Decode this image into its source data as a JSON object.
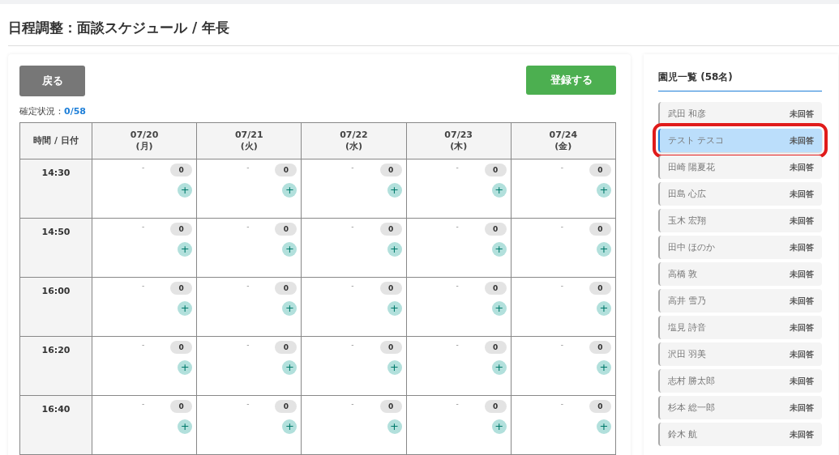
{
  "page_title": "日程調整：面談スケジュール / 年長",
  "back_button": "戻る",
  "register_button": "登録する",
  "status": {
    "label": "確定状況：",
    "value": "0/58"
  },
  "table": {
    "corner": "時間 / 日付",
    "columns": [
      {
        "date": "07/20",
        "weekday": "(月)"
      },
      {
        "date": "07/21",
        "weekday": "(火)"
      },
      {
        "date": "07/22",
        "weekday": "(水)"
      },
      {
        "date": "07/23",
        "weekday": "(木)"
      },
      {
        "date": "07/24",
        "weekday": "(金)"
      }
    ],
    "rows": [
      {
        "time": "14:30",
        "cells": [
          {
            "note": "-",
            "count": "0",
            "add": "+"
          },
          {
            "note": "-",
            "count": "0",
            "add": "+"
          },
          {
            "note": "-",
            "count": "0",
            "add": "+"
          },
          {
            "note": "-",
            "count": "0",
            "add": "+"
          },
          {
            "note": "-",
            "count": "0",
            "add": "+"
          }
        ]
      },
      {
        "time": "14:50",
        "cells": [
          {
            "note": "-",
            "count": "0",
            "add": "+"
          },
          {
            "note": "-",
            "count": "0",
            "add": "+"
          },
          {
            "note": "-",
            "count": "0",
            "add": "+"
          },
          {
            "note": "-",
            "count": "0",
            "add": "+"
          },
          {
            "note": "-",
            "count": "0",
            "add": "+"
          }
        ]
      },
      {
        "time": "16:00",
        "cells": [
          {
            "note": "-",
            "count": "0",
            "add": "+"
          },
          {
            "note": "-",
            "count": "0",
            "add": "+"
          },
          {
            "note": "-",
            "count": "0",
            "add": "+"
          },
          {
            "note": "-",
            "count": "0",
            "add": "+"
          },
          {
            "note": "-",
            "count": "0",
            "add": "+"
          }
        ]
      },
      {
        "time": "16:20",
        "cells": [
          {
            "note": "-",
            "count": "0",
            "add": "+"
          },
          {
            "note": "-",
            "count": "0",
            "add": "+"
          },
          {
            "note": "-",
            "count": "0",
            "add": "+"
          },
          {
            "note": "-",
            "count": "0",
            "add": "+"
          },
          {
            "note": "-",
            "count": "0",
            "add": "+"
          }
        ]
      },
      {
        "time": "16:40",
        "cells": [
          {
            "note": "-",
            "count": "0",
            "add": "+"
          },
          {
            "note": "-",
            "count": "0",
            "add": "+"
          },
          {
            "note": "-",
            "count": "0",
            "add": "+"
          },
          {
            "note": "-",
            "count": "0",
            "add": "+"
          },
          {
            "note": "-",
            "count": "0",
            "add": "+"
          }
        ]
      }
    ]
  },
  "sidebar": {
    "title": "園児一覧 (58名)",
    "items": [
      {
        "name": "武田 和彦",
        "status": "未回答",
        "selected": false,
        "highlighted": false
      },
      {
        "name": "テスト テスコ",
        "status": "未回答",
        "selected": true,
        "highlighted": true
      },
      {
        "name": "田崎 陽夏花",
        "status": "未回答",
        "selected": false,
        "highlighted": false
      },
      {
        "name": "田島 心広",
        "status": "未回答",
        "selected": false,
        "highlighted": false
      },
      {
        "name": "玉木 宏翔",
        "status": "未回答",
        "selected": false,
        "highlighted": false
      },
      {
        "name": "田中 ほのか",
        "status": "未回答",
        "selected": false,
        "highlighted": false
      },
      {
        "name": "高橋 敦",
        "status": "未回答",
        "selected": false,
        "highlighted": false
      },
      {
        "name": "高井 雪乃",
        "status": "未回答",
        "selected": false,
        "highlighted": false
      },
      {
        "name": "塩見 詩音",
        "status": "未回答",
        "selected": false,
        "highlighted": false
      },
      {
        "name": "沢田 羽美",
        "status": "未回答",
        "selected": false,
        "highlighted": false
      },
      {
        "name": "志村 勝太郎",
        "status": "未回答",
        "selected": false,
        "highlighted": false
      },
      {
        "name": "杉本 総一郎",
        "status": "未回答",
        "selected": false,
        "highlighted": false
      },
      {
        "name": "鈴木 航",
        "status": "未回答",
        "selected": false,
        "highlighted": false
      }
    ]
  }
}
